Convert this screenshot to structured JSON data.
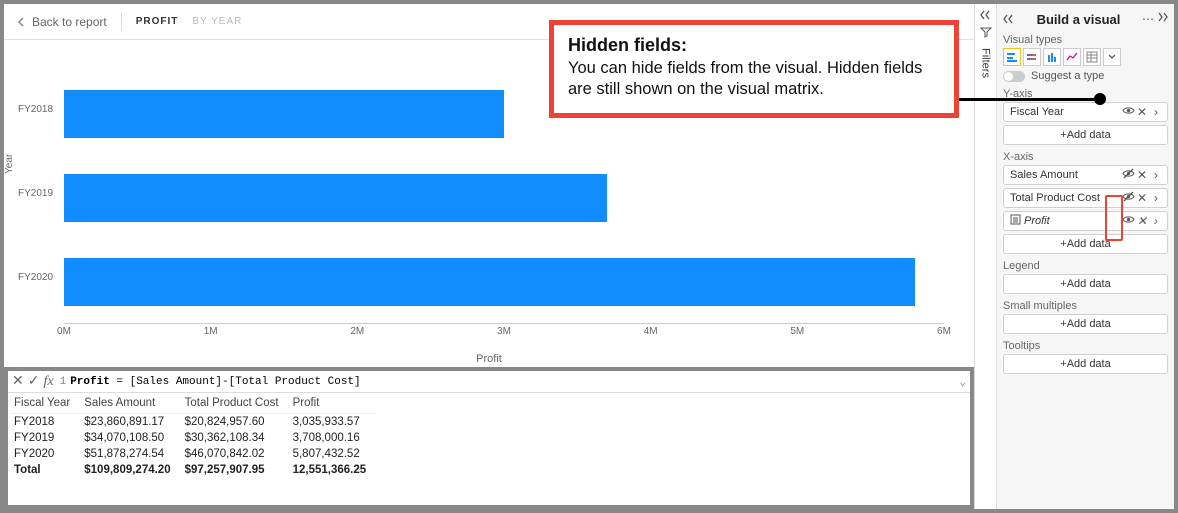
{
  "header": {
    "back": "Back to report",
    "tab_active": "PROFIT",
    "tab_other": "BY YEAR"
  },
  "chart_data": {
    "type": "bar",
    "orientation": "horizontal",
    "categories": [
      "FY2018",
      "FY2019",
      "FY2020"
    ],
    "values": [
      3.0,
      3.7,
      5.8
    ],
    "title": "",
    "xlabel": "Profit",
    "ylabel": "Year",
    "xlim": [
      0,
      6
    ],
    "xticks": [
      "0M",
      "1M",
      "2M",
      "3M",
      "4M",
      "5M",
      "6M"
    ]
  },
  "formula": {
    "line_no": "1",
    "name": "Profit",
    "eq": " = ",
    "body": "[Sales Amount]-[Total Product Cost]"
  },
  "matrix": {
    "cols": [
      "Fiscal Year",
      "Sales Amount",
      "Total Product Cost",
      "Profit"
    ],
    "rows": [
      [
        "FY2018",
        "$23,860,891.17",
        "$20,824,957.60",
        "3,035,933.57"
      ],
      [
        "FY2019",
        "$34,070,108.50",
        "$30,362,108.34",
        "3,708,000.16"
      ],
      [
        "FY2020",
        "$51,878,274.54",
        "$46,070,842.02",
        "5,807,432.52"
      ]
    ],
    "total": [
      "Total",
      "$109,809,274.20",
      "$97,257,907.95",
      "12,551,366.25"
    ]
  },
  "filters_label": "Filters",
  "build": {
    "title": "Build a visual",
    "types_label": "Visual types",
    "suggest": "Suggest a type",
    "wells": {
      "yaxis": {
        "label": "Y-axis",
        "chips": [
          {
            "name": "Fiscal Year",
            "hidden": false,
            "measure": false
          }
        ],
        "add": "+Add data"
      },
      "xaxis": {
        "label": "X-axis",
        "chips": [
          {
            "name": "Sales Amount",
            "hidden": true,
            "measure": false
          },
          {
            "name": "Total Product Cost",
            "hidden": true,
            "measure": false
          },
          {
            "name": "Profit",
            "hidden": false,
            "measure": true
          }
        ],
        "add": "+Add data"
      },
      "legend": {
        "label": "Legend",
        "add": "+Add data"
      },
      "sm": {
        "label": "Small multiples",
        "add": "+Add data"
      },
      "tooltips": {
        "label": "Tooltips",
        "add": "+Add data"
      }
    }
  },
  "callout": {
    "title": "Hidden fields:",
    "body": "You can hide fields from the visual. Hidden fields are still shown on the visual matrix."
  }
}
